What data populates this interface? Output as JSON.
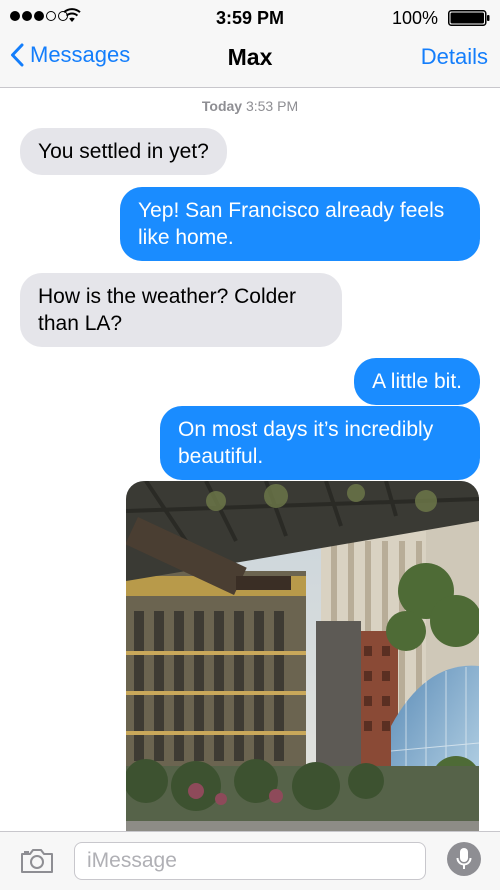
{
  "status_bar": {
    "time": "3:59 PM",
    "battery_percent": "100%",
    "battery_level": 1.0,
    "signal_bars_filled": 3,
    "signal_bars_total": 5
  },
  "nav": {
    "back_label": "Messages",
    "title": "Max",
    "details_label": "Details"
  },
  "timestamp": {
    "day": "Today",
    "time": "3:53 PM"
  },
  "messages": [
    {
      "direction": "incoming",
      "text": "You settled in yet?"
    },
    {
      "direction": "outgoing",
      "text": "Yep! San Francisco already feels like home."
    },
    {
      "direction": "incoming",
      "text": "How is the weather? Colder than LA?"
    },
    {
      "direction": "outgoing",
      "text": "A little bit."
    },
    {
      "direction": "outgoing",
      "text": "On most days it’s incredibly beautiful."
    },
    {
      "direction": "outgoing",
      "type": "photo"
    }
  ],
  "input": {
    "placeholder": "iMessage",
    "value": ""
  },
  "colors": {
    "accent": "#147efb",
    "outgoing_bubble": "#1a8cff",
    "incoming_bubble": "#e5e5ea"
  }
}
